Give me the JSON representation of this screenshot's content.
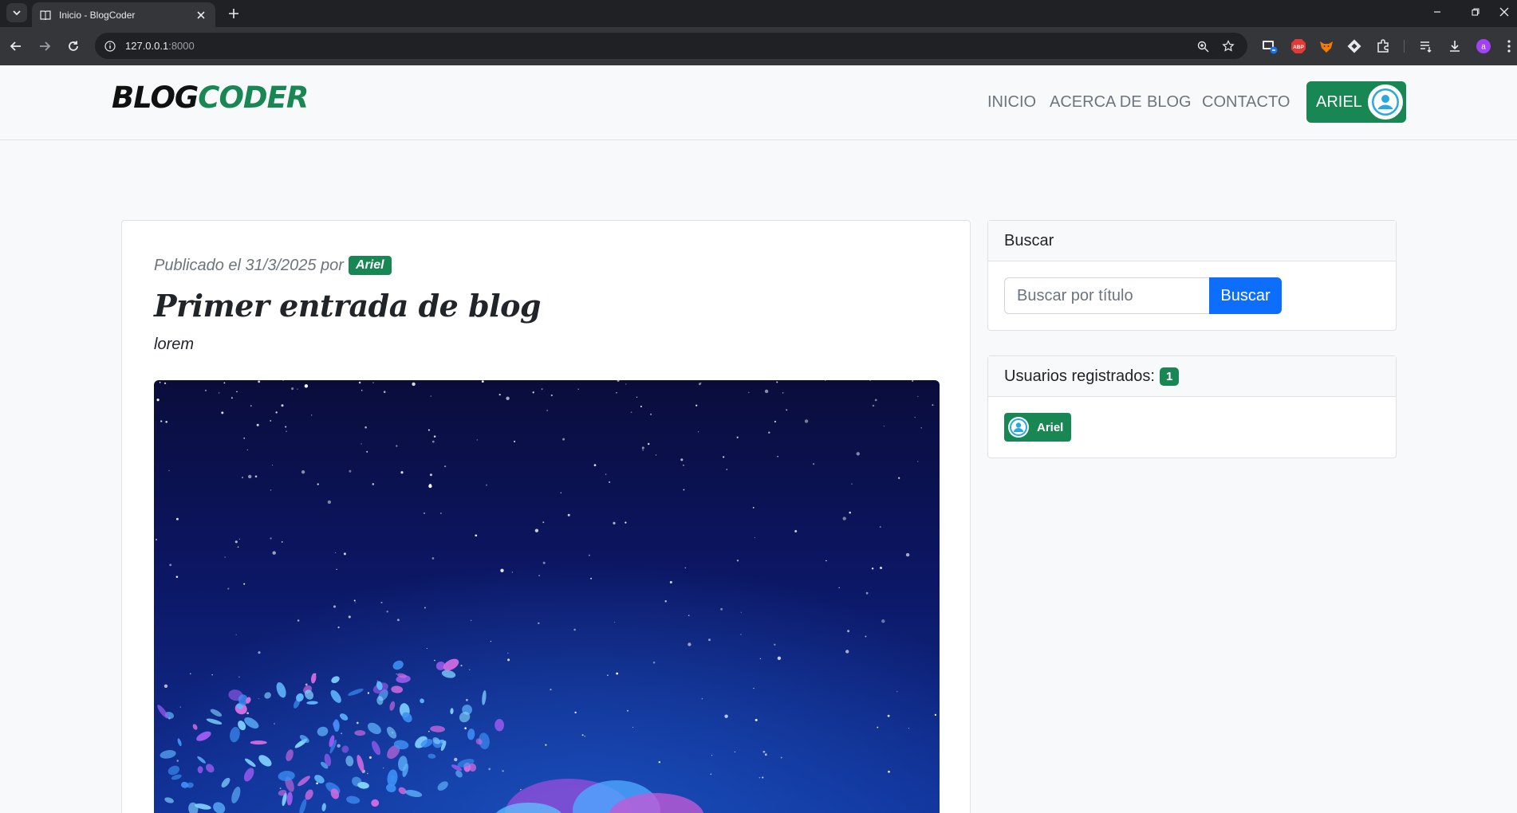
{
  "browser": {
    "tab_title": "Inicio - BlogCoder",
    "url_host": "127.0.0.1",
    "url_port": ":8000"
  },
  "site": {
    "brand_part1": "BLOG",
    "brand_part2": "CODER",
    "nav": [
      "INICIO",
      "ACERCA DE",
      "BLOG",
      "CONTACTO"
    ],
    "user_label": "ARIEL"
  },
  "post": {
    "published_prefix": "Publicado el 31/3/2025 por",
    "author": "Ariel",
    "title": "Primer entrada de blog",
    "subtitle": "lorem"
  },
  "sidebar": {
    "search": {
      "heading": "Buscar",
      "placeholder": "Buscar por título",
      "button": "Buscar"
    },
    "users": {
      "heading": "Usuarios registrados:",
      "count": "1",
      "list": [
        "Ariel"
      ]
    }
  },
  "colors": {
    "brand_green": "#198754",
    "primary_blue": "#0d6efd",
    "navbar_bg": "#f8f9fa"
  }
}
